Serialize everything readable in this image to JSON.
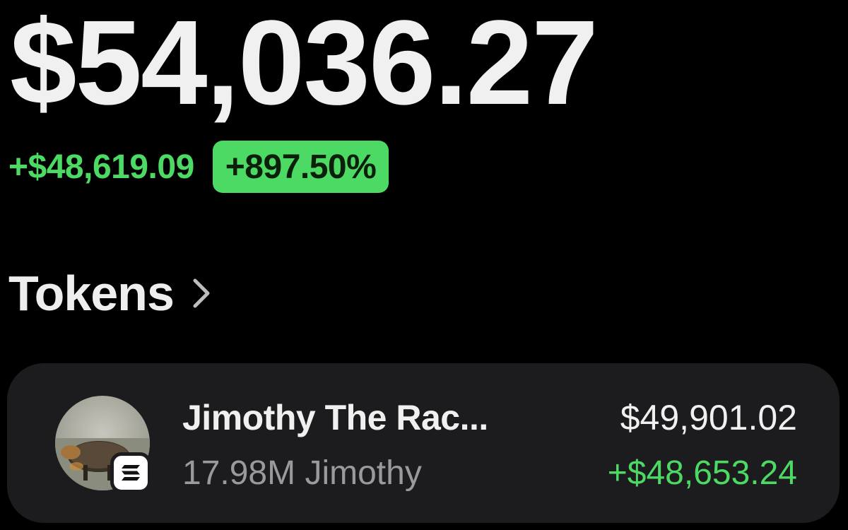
{
  "portfolio": {
    "balance": "$54,036.27",
    "change_amount": "+$48,619.09",
    "change_percent": "+897.50%"
  },
  "tokens_section": {
    "title": "Tokens",
    "chevron_icon": "chevron-right-icon"
  },
  "tokens": [
    {
      "name": "Jimothy The Rac...",
      "quantity": "17.98M Jimothy",
      "value": "$49,901.02",
      "change": "+$48,653.24",
      "avatar_icon": "raccoon-avatar",
      "chain_icon": "solana-icon"
    }
  ],
  "colors": {
    "background": "#000000",
    "card": "#1c1c1e",
    "positive": "#4cd964",
    "text_primary": "#f0f0f0",
    "text_secondary": "#9a9a9e"
  }
}
